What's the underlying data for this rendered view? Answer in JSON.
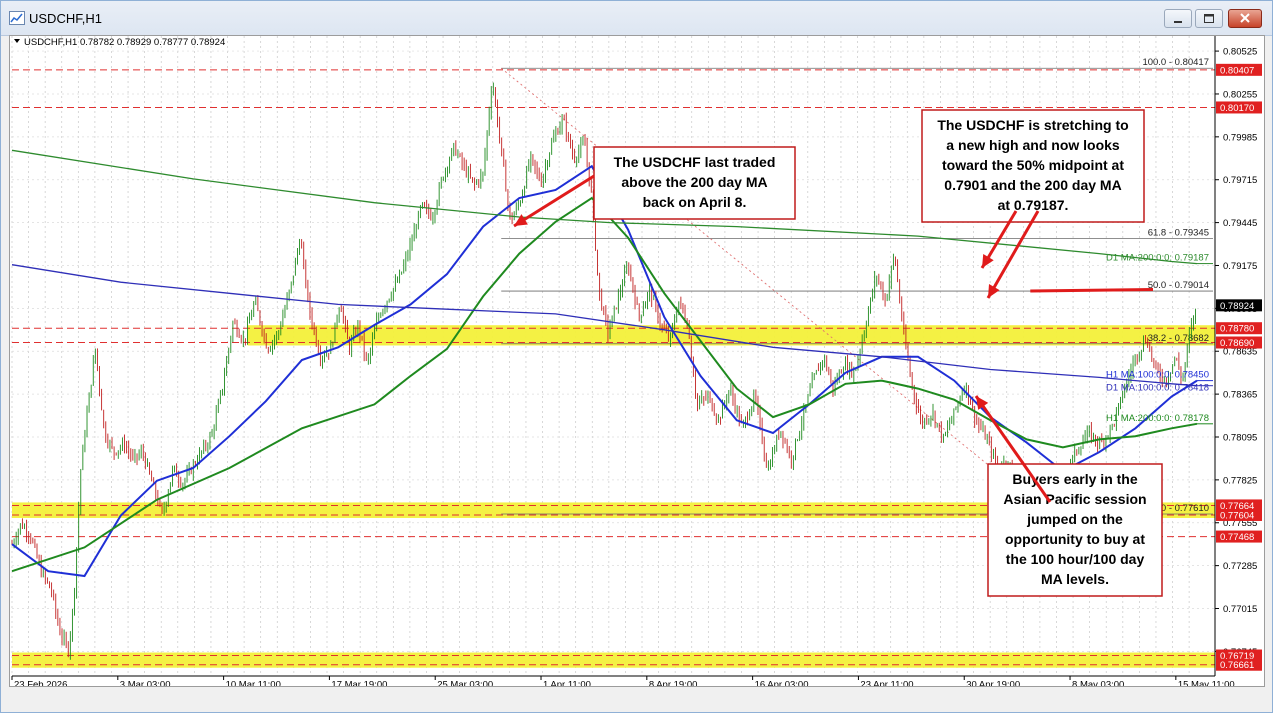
{
  "window": {
    "title": "USDCHF,H1"
  },
  "chart_data": {
    "type": "line",
    "title": "USDCHF,H1",
    "ohlc_header": "USDCHF,H1  0.78782 0.78929 0.78777 0.78924",
    "symbol": "USDCHF",
    "timeframe": "H1",
    "ohlc": {
      "open": 0.78782,
      "high": 0.78929,
      "low": 0.78777,
      "close": 0.78924
    },
    "ylim": [
      0.7659,
      0.8062
    ],
    "y_ticks": [
      0.80525,
      0.80255,
      0.79985,
      0.79715,
      0.79445,
      0.79175,
      0.78905,
      0.78635,
      0.78365,
      0.78095,
      0.77825,
      0.77555,
      0.77285,
      0.77015,
      0.76745
    ],
    "y_tick_labels": [
      "0.80525",
      "0.80255",
      "0.79985",
      "0.79715",
      "0.79445",
      "0.79175",
      "0.78905",
      "0.78635",
      "0.78365",
      "0.78095",
      "0.77825",
      "0.77555",
      "0.77285",
      "0.77015",
      "0.76745"
    ],
    "x_tick_labels": [
      "23 Feb 2026",
      "3 Mar 03:00",
      "10 Mar 11:00",
      "17 Mar 19:00",
      "25 Mar 03:00",
      "1 Apr 11:00",
      "8 Apr 19:00",
      "16 Apr 03:00",
      "23 Apr 11:00",
      "30 Apr 19:00",
      "8 May 03:00",
      "15 May 11:00"
    ],
    "grid": true,
    "price_path": [
      [
        0,
        0.7742
      ],
      [
        0.5,
        0.7755
      ],
      [
        1,
        0.7748
      ],
      [
        1.6,
        0.7725
      ],
      [
        2.2,
        0.7712
      ],
      [
        2.6,
        0.7688
      ],
      [
        3.1,
        0.7675
      ],
      [
        3.4,
        0.7705
      ],
      [
        3.8,
        0.779
      ],
      [
        4.2,
        0.783
      ],
      [
        4.6,
        0.7865
      ],
      [
        5.1,
        0.7812
      ],
      [
        5.6,
        0.78
      ],
      [
        6.2,
        0.7805
      ],
      [
        6.7,
        0.7795
      ],
      [
        7.2,
        0.78
      ],
      [
        7.8,
        0.7778
      ],
      [
        8.3,
        0.776
      ],
      [
        8.9,
        0.779
      ],
      [
        9.4,
        0.778
      ],
      [
        10.2,
        0.7795
      ],
      [
        11,
        0.781
      ],
      [
        11.6,
        0.784
      ],
      [
        12.2,
        0.7882
      ],
      [
        12.8,
        0.787
      ],
      [
        13.4,
        0.7895
      ],
      [
        14.1,
        0.7865
      ],
      [
        14.7,
        0.7875
      ],
      [
        15.4,
        0.7905
      ],
      [
        15.9,
        0.7935
      ],
      [
        16.4,
        0.789
      ],
      [
        17,
        0.786
      ],
      [
        17.6,
        0.7865
      ],
      [
        18.1,
        0.7895
      ],
      [
        18.6,
        0.7865
      ],
      [
        19.1,
        0.788
      ],
      [
        19.6,
        0.7855
      ],
      [
        20.2,
        0.7885
      ],
      [
        20.8,
        0.7898
      ],
      [
        21.4,
        0.791
      ],
      [
        22,
        0.793
      ],
      [
        22.6,
        0.7955
      ],
      [
        23.2,
        0.7948
      ],
      [
        23.8,
        0.7975
      ],
      [
        24.4,
        0.7992
      ],
      [
        24.9,
        0.798
      ],
      [
        25.5,
        0.7968
      ],
      [
        26,
        0.7975
      ],
      [
        26.5,
        0.8035
      ],
      [
        27,
        0.799
      ],
      [
        27.5,
        0.7945
      ],
      [
        28.1,
        0.796
      ],
      [
        28.6,
        0.7985
      ],
      [
        29.2,
        0.797
      ],
      [
        29.8,
        0.7995
      ],
      [
        30.4,
        0.801
      ],
      [
        31,
        0.7985
      ],
      [
        31.6,
        0.7995
      ],
      [
        32,
        0.796
      ],
      [
        32.4,
        0.79
      ],
      [
        32.9,
        0.7875
      ],
      [
        33.4,
        0.7895
      ],
      [
        34,
        0.7918
      ],
      [
        34.6,
        0.7885
      ],
      [
        35.2,
        0.7902
      ],
      [
        35.8,
        0.788
      ],
      [
        36.3,
        0.787
      ],
      [
        36.8,
        0.7895
      ],
      [
        37.3,
        0.788
      ],
      [
        37.8,
        0.783
      ],
      [
        38.4,
        0.7835
      ],
      [
        39,
        0.782
      ],
      [
        39.6,
        0.784
      ],
      [
        40.3,
        0.7815
      ],
      [
        41,
        0.7835
      ],
      [
        41.7,
        0.7788
      ],
      [
        42.4,
        0.7815
      ],
      [
        43,
        0.7795
      ],
      [
        43.6,
        0.782
      ],
      [
        44.2,
        0.7845
      ],
      [
        44.8,
        0.786
      ],
      [
        45.3,
        0.784
      ],
      [
        45.9,
        0.7855
      ],
      [
        46.5,
        0.785
      ],
      [
        47.1,
        0.788
      ],
      [
        47.7,
        0.7912
      ],
      [
        48.2,
        0.7895
      ],
      [
        48.7,
        0.7925
      ],
      [
        49.2,
        0.7875
      ],
      [
        49.7,
        0.784
      ],
      [
        50.2,
        0.7818
      ],
      [
        50.8,
        0.7825
      ],
      [
        51.4,
        0.7808
      ],
      [
        52,
        0.7825
      ],
      [
        52.6,
        0.7843
      ],
      [
        53.2,
        0.782
      ],
      [
        53.8,
        0.7808
      ],
      [
        54.4,
        0.779
      ],
      [
        55,
        0.7795
      ],
      [
        55.6,
        0.7772
      ],
      [
        56.2,
        0.7782
      ],
      [
        56.8,
        0.7762
      ],
      [
        57.4,
        0.7775
      ],
      [
        58,
        0.7782
      ],
      [
        58.7,
        0.78
      ],
      [
        59.4,
        0.7812
      ],
      [
        60.1,
        0.7805
      ],
      [
        60.8,
        0.7818
      ],
      [
        61.4,
        0.784
      ],
      [
        62,
        0.786
      ],
      [
        62.6,
        0.7872
      ],
      [
        63.1,
        0.7852
      ],
      [
        63.7,
        0.7845
      ],
      [
        64.2,
        0.786
      ],
      [
        64.6,
        0.7845
      ],
      [
        65,
        0.7875
      ],
      [
        65.4,
        0.7892
      ]
    ],
    "series": [
      {
        "name": "H1 MA:100:0:0",
        "color": "#1f2fd6",
        "x": [
          0,
          2,
          4,
          6,
          8,
          10,
          12,
          14,
          16,
          18,
          20,
          22,
          24,
          26,
          28,
          30,
          32,
          34,
          36,
          38,
          40,
          42,
          44,
          46,
          48,
          50,
          52,
          54,
          56,
          58,
          60,
          62,
          64,
          65.4
        ],
        "values": [
          0.7742,
          0.7725,
          0.7722,
          0.776,
          0.7782,
          0.779,
          0.781,
          0.7832,
          0.7858,
          0.7866,
          0.788,
          0.7893,
          0.7912,
          0.7942,
          0.796,
          0.7965,
          0.798,
          0.794,
          0.7885,
          0.7848,
          0.782,
          0.7812,
          0.783,
          0.785,
          0.786,
          0.786,
          0.7845,
          0.7822,
          0.7806,
          0.7788,
          0.78,
          0.7815,
          0.7835,
          0.7845
        ]
      },
      {
        "name": "H1 MA:200:0:0",
        "color": "#1f8a1f",
        "label": "H1 MA:200:0:0: 0.78178",
        "x": [
          0,
          4,
          8,
          12,
          16,
          20,
          22,
          24,
          26,
          28,
          30,
          32,
          34,
          36,
          38,
          40,
          42,
          44,
          46,
          48,
          50,
          52,
          54,
          56,
          58,
          60,
          62,
          64,
          65.4
        ],
        "values": [
          0.7725,
          0.774,
          0.777,
          0.779,
          0.7815,
          0.783,
          0.7848,
          0.7865,
          0.7898,
          0.7925,
          0.7945,
          0.796,
          0.7935,
          0.79,
          0.787,
          0.784,
          0.7822,
          0.783,
          0.7843,
          0.7845,
          0.784,
          0.7833,
          0.782,
          0.7808,
          0.7803,
          0.7808,
          0.781,
          0.7815,
          0.78178
        ]
      },
      {
        "name": "D1 MA:200:0:0",
        "color": "#2e8b2e",
        "label": "D1 MA:200:0:0: 0.79187",
        "x": [
          0,
          10,
          20,
          28,
          33,
          40,
          50,
          60,
          64,
          65.4
        ],
        "values": [
          0.799,
          0.7972,
          0.7957,
          0.7948,
          0.79445,
          0.7942,
          0.7936,
          0.7925,
          0.792,
          0.79187
        ]
      },
      {
        "name": "D1 MA:100:0:0",
        "color": "#2f2fb8",
        "x": [
          0,
          6,
          12,
          18,
          24,
          30,
          36,
          42,
          48,
          54,
          60,
          64,
          65.4
        ],
        "values": [
          0.7918,
          0.7907,
          0.79,
          0.7893,
          0.789,
          0.7887,
          0.7877,
          0.7866,
          0.786,
          0.7852,
          0.7847,
          0.7843,
          0.78418
        ]
      }
    ],
    "horizontal_levels": [
      {
        "label": "0.80407",
        "value": 0.80407,
        "color": "#e03030",
        "style": "dashed"
      },
      {
        "label": "0.80170",
        "value": 0.8017,
        "color": "#e03030",
        "style": "dashed"
      },
      {
        "label": "0.78780",
        "value": 0.7878,
        "color": "#e03030",
        "style": "dashed"
      },
      {
        "label": "0.78690",
        "value": 0.7869,
        "color": "#e03030",
        "style": "dashed"
      },
      {
        "label": "0.77664",
        "value": 0.77664,
        "color": "#e03030",
        "style": "dashed"
      },
      {
        "label": "0.77604",
        "value": 0.77604,
        "color": "#e03030",
        "style": "dashed"
      },
      {
        "label": "0.77468",
        "value": 0.77468,
        "color": "#e03030",
        "style": "dashed"
      },
      {
        "label": "0.76719",
        "value": 0.76719,
        "color": "#e03030",
        "style": "dashed"
      },
      {
        "label": "0.76661",
        "value": 0.76661,
        "color": "#e03030",
        "style": "dashed"
      }
    ],
    "current_price": {
      "label": "0.78924",
      "value": 0.78924
    },
    "support_zones": [
      [
        0.7869,
        0.7878
      ],
      [
        0.77604,
        0.77664
      ],
      [
        0.76661,
        0.76719
      ]
    ],
    "fibonacci": [
      {
        "label": "100.0 - 0.80417",
        "value": 0.80417
      },
      {
        "label": "61.8 - 0.79345",
        "value": 0.79345
      },
      {
        "label": "50.0 - 0.79014",
        "value": 0.79014
      },
      {
        "label": "38.2 - 0.78682",
        "value": 0.78682
      },
      {
        "label": "0.0 - 0.77610",
        "value": 0.7761
      }
    ],
    "ma_labels": [
      {
        "label": "D1 MA:200:0:0: 0.79187",
        "value": 0.79187,
        "color": "#2e8b2e"
      },
      {
        "label": "H1 MA:100:0:0: 0.78450",
        "value": 0.7845,
        "color": "#1f2fd6"
      },
      {
        "label": "D1 MA:100:0:0: 0.78418",
        "value": 0.78418,
        "color": "#2f2fb8"
      },
      {
        "label": "H1 MA:200:0:0: 0.78178",
        "value": 0.78178,
        "color": "#1f8a1f"
      }
    ],
    "annotations": [
      {
        "text": "The USDCHF last traded above the 200 day MA back on April 8."
      },
      {
        "text": "The USDCHF is stretching to a new high and now looks toward the 50% midpoint at 0.7901 and the 200 day MA at 0.79187."
      },
      {
        "text": "Buyers early in the Asian Pacific session jumped on the opportunity to buy at the 100 hour/100 day MA levels."
      }
    ]
  },
  "colors": {
    "price_up": "#1e8a1e",
    "price_down": "#c02020",
    "zone": "#f3f03a",
    "level": "#e03030",
    "arrow": "#e01b1b"
  }
}
